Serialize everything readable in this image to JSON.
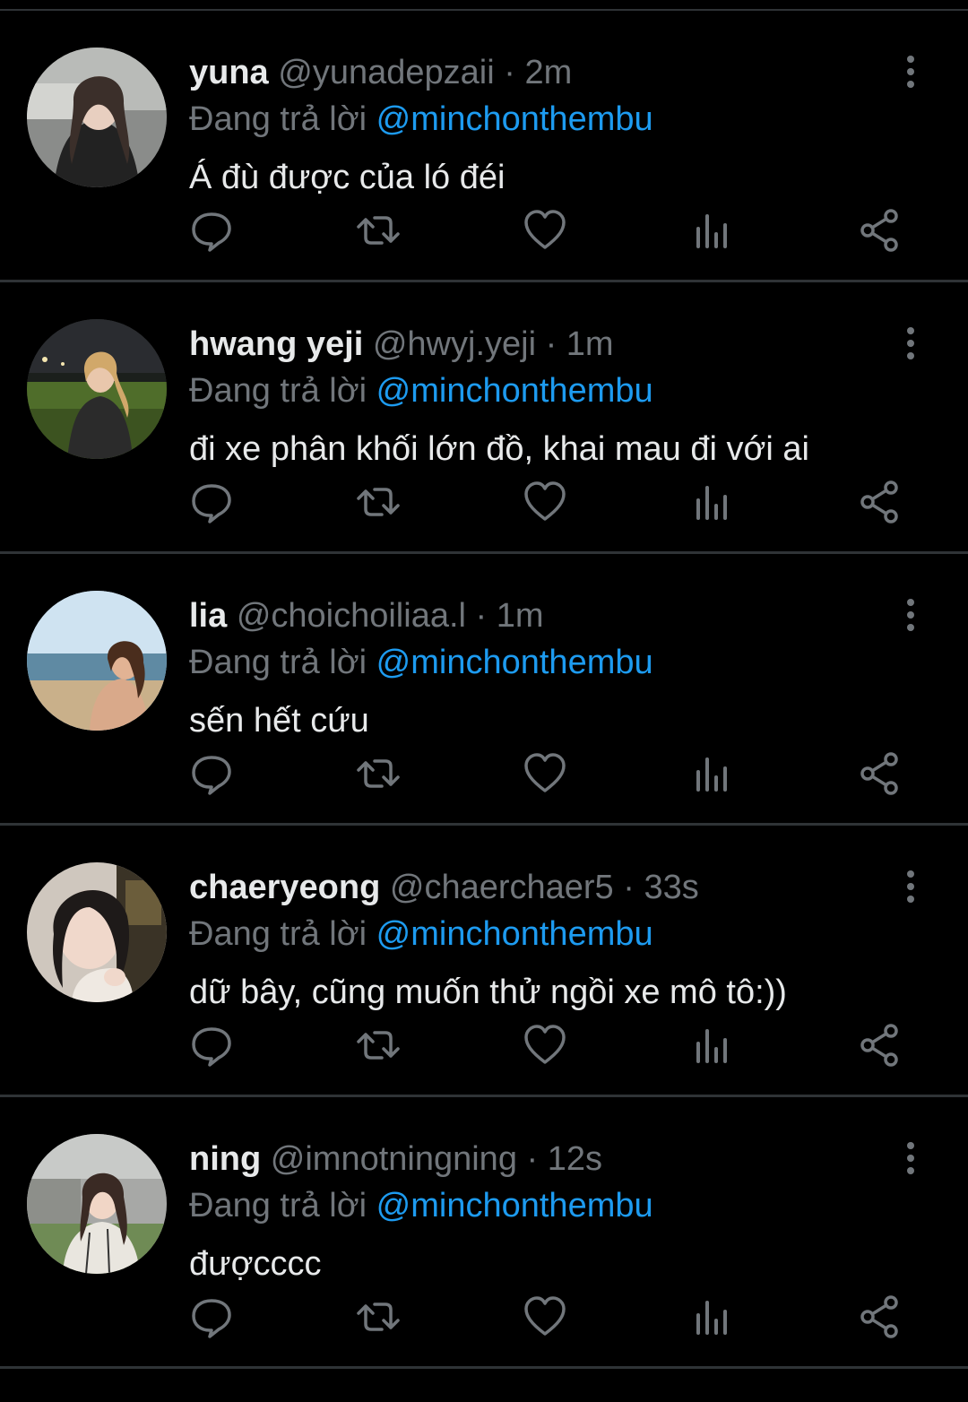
{
  "colors": {
    "background": "#000000",
    "divider": "#2f3336",
    "primary_text": "#e7e9ea",
    "secondary_text": "#71767b",
    "mention": "#1d9bf0"
  },
  "icons": {
    "reply": "reply-icon",
    "retweet": "retweet-icon",
    "like": "heart-icon",
    "views": "views-icon",
    "share": "share-icon",
    "more": "more-icon"
  },
  "tweets": [
    {
      "name": "yuna",
      "handle": "@yunadepzaii",
      "separator": "·",
      "time": "2m",
      "reply_prefix": "Đang trả lời",
      "reply_to": "@minchonthembu",
      "text": "Á đù được của ló đéi"
    },
    {
      "name": "hwang yeji",
      "handle": "@hwyj.yeji",
      "separator": "·",
      "time": "1m",
      "reply_prefix": "Đang trả lời",
      "reply_to": "@minchonthembu",
      "text": "đi xe phân khối lớn đồ, khai mau đi với ai"
    },
    {
      "name": "lia",
      "handle": "@choichoiliaa.l",
      "separator": "·",
      "time": "1m",
      "reply_prefix": "Đang trả lời",
      "reply_to": "@minchonthembu",
      "text": "sến hết cứu"
    },
    {
      "name": "chaeryeong",
      "handle": "@chaerchaer5",
      "separator": "·",
      "time": "33s",
      "reply_prefix": "Đang trả lời",
      "reply_to": "@minchonthembu",
      "text": "dữ bây, cũng muốn thử ngồi xe mô tô:))"
    },
    {
      "name": "ning",
      "handle": "@imnotningning",
      "separator": "·",
      "time": "12s",
      "reply_prefix": "Đang trả lời",
      "reply_to": "@minchonthembu",
      "text": "đượcccc"
    }
  ]
}
